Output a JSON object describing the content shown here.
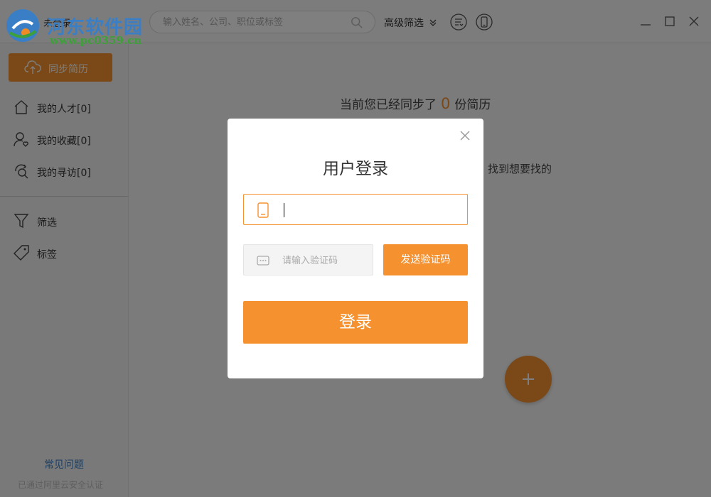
{
  "watermark": {
    "site_name": "河东软件园",
    "url": "www.pc0359.cn"
  },
  "header": {
    "user_status": "未登录",
    "search_placeholder": "输入姓名、公司、职位或标签",
    "advanced_filter_label": "高级筛选",
    "icons": [
      "sort-icon",
      "mobile-icon",
      "minimize-icon",
      "maximize-icon",
      "close-icon"
    ]
  },
  "sidebar": {
    "sync_button_label": "同步简历",
    "items": [
      {
        "label": "我的人才[0]",
        "icon": "home-icon"
      },
      {
        "label": "我的收藏[0]",
        "icon": "user-heart-icon"
      },
      {
        "label": "我的寻访[0]",
        "icon": "refresh-search-icon"
      },
      {
        "label": "筛选",
        "icon": "filter-icon"
      },
      {
        "label": "标签",
        "icon": "tag-icon"
      }
    ],
    "faq_label": "常见问题",
    "certification_text": "已通过阿里云安全认证"
  },
  "main": {
    "status_prefix": "当前您已经同步了",
    "synced_count": "0",
    "status_suffix": "份简历",
    "hint_text": "找到想要找的"
  },
  "login_modal": {
    "title": "用户登录",
    "phone_value": "",
    "code_placeholder": "请输入验证码",
    "send_code_label": "发送验证码",
    "login_label": "登录"
  },
  "colors": {
    "accent": "#f5922f",
    "link": "#3a7fc6"
  }
}
